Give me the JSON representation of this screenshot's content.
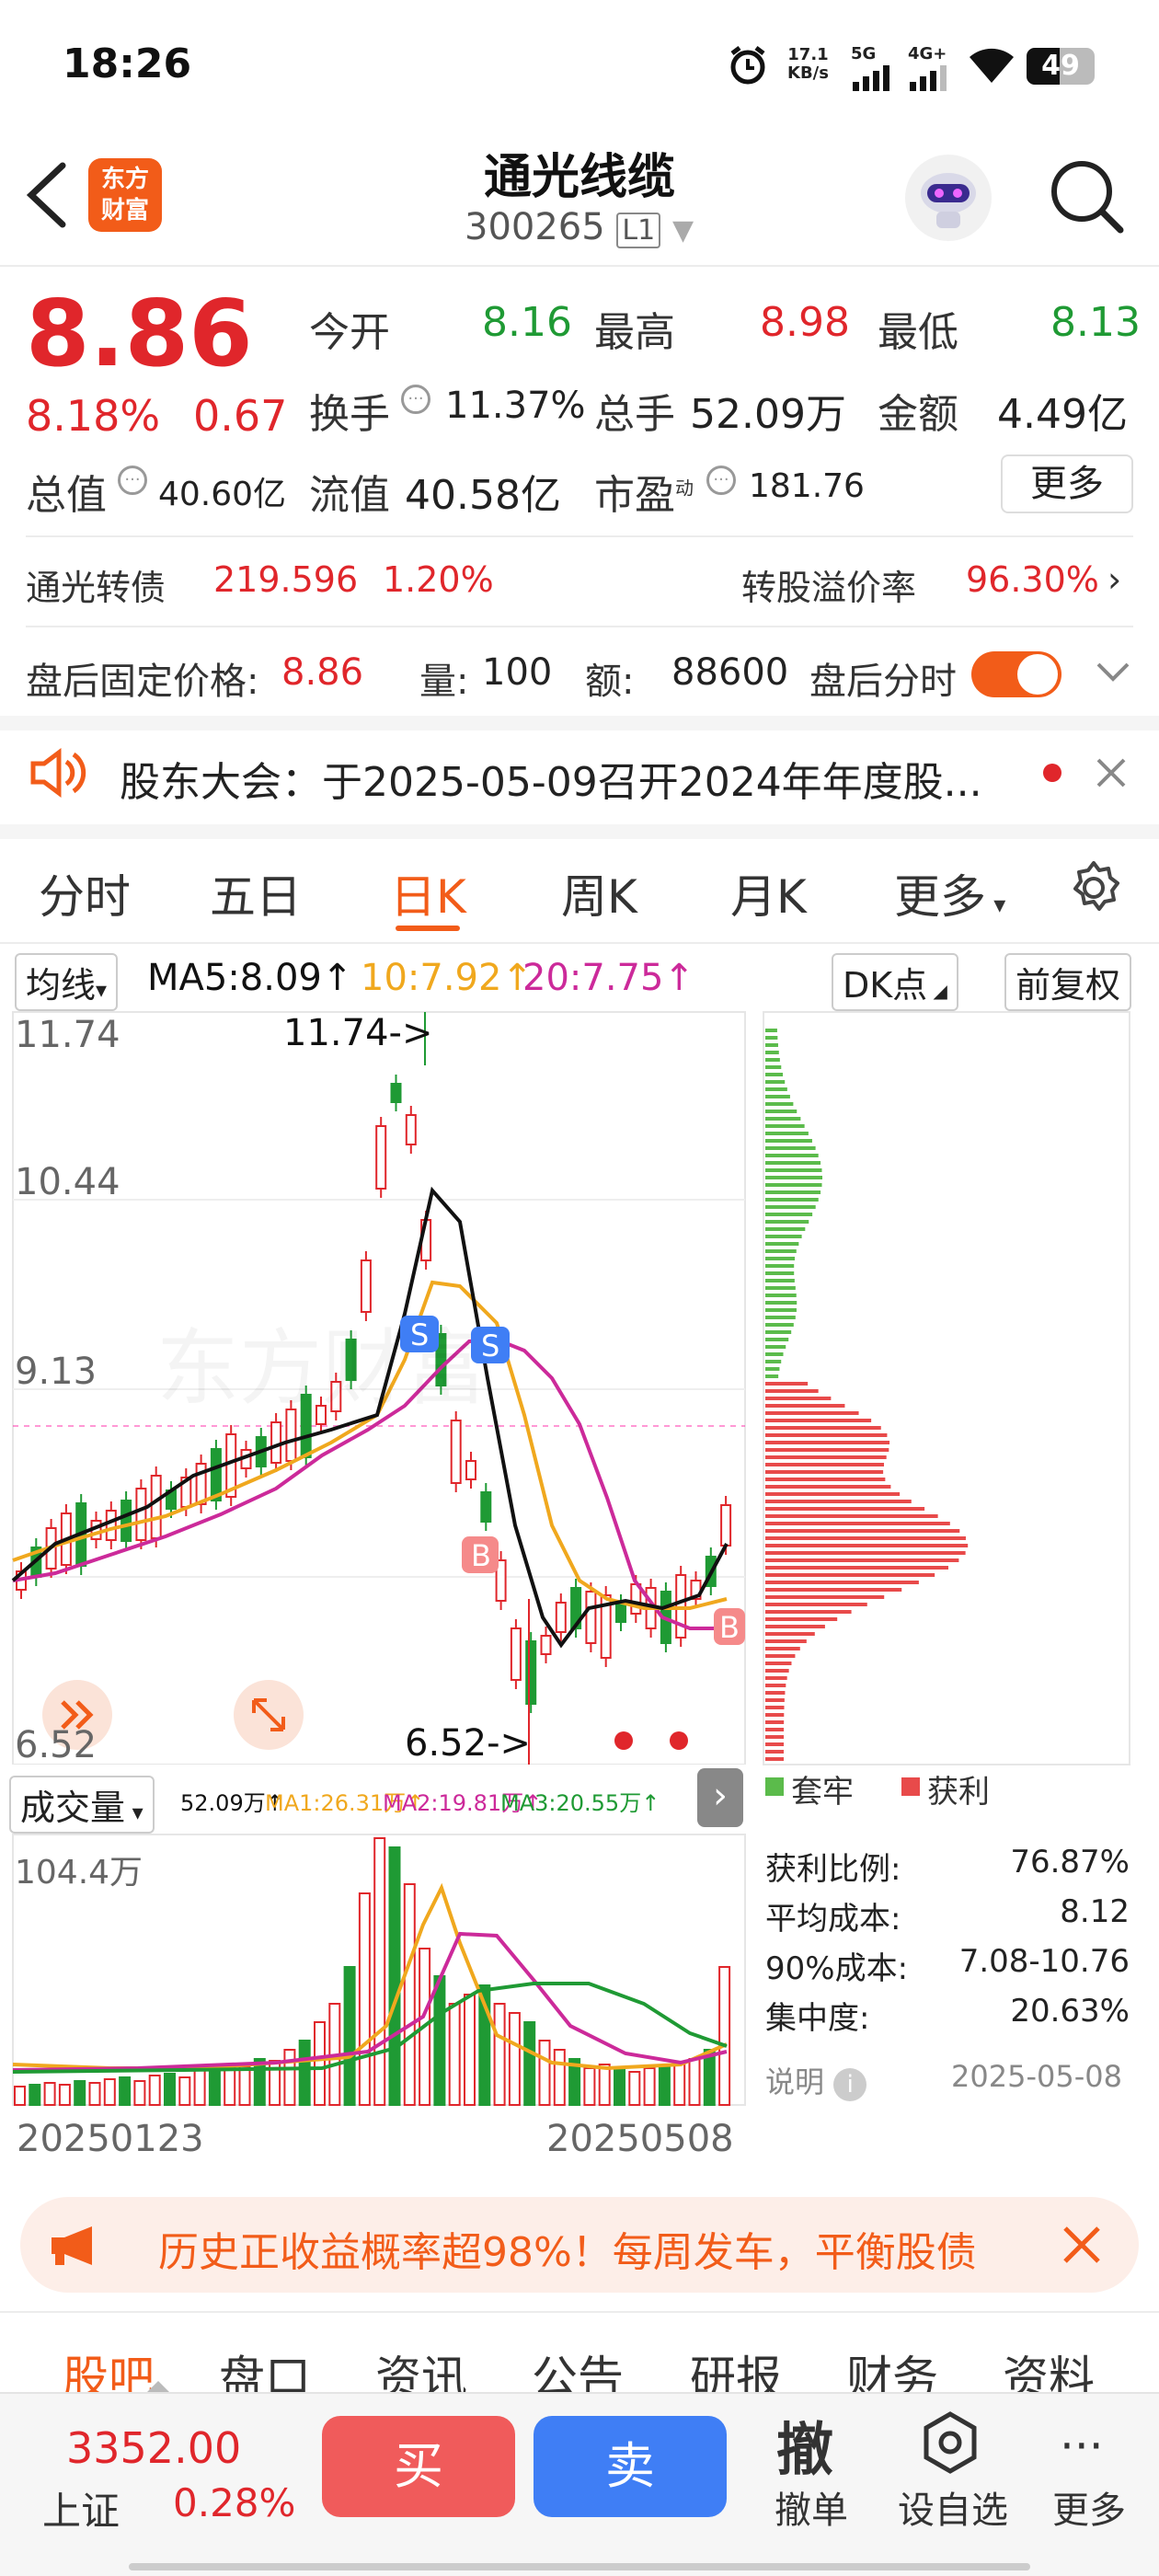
{
  "status_bar": {
    "time": "18:26",
    "net_speed_top": "17.1",
    "net_speed_bottom": "KB/s",
    "sig1": "5G",
    "sig2": "4G+",
    "battery": "49"
  },
  "header": {
    "logo_line1": "东方",
    "logo_line2": "财富",
    "title": "通光线缆",
    "code": "300265",
    "level": "L1"
  },
  "quote": {
    "price": "8.86",
    "pct": "8.18%",
    "change": "0.67",
    "open_label": "今开",
    "open": "8.16",
    "high_label": "最高",
    "high": "8.98",
    "low_label": "最低",
    "low": "8.13",
    "turnover_label": "换手",
    "turnover": "11.37%",
    "volume_label": "总手",
    "volume": "52.09万",
    "amount_label": "金额",
    "amount": "4.49亿",
    "mcap_label": "总值",
    "mcap": "40.60亿",
    "float_label": "流值",
    "float": "40.58亿",
    "pe_label": "市盈",
    "pe_sup": "动",
    "pe": "181.76",
    "more": "更多"
  },
  "bond": {
    "name": "通光转债",
    "price": "219.596",
    "pct": "1.20%",
    "premium_label": "转股溢价率",
    "premium": "96.30%"
  },
  "after_hours": {
    "label": "盘后固定价格:",
    "price": "8.86",
    "vol_label": "量:",
    "vol": "100",
    "amt_label": "额:",
    "amt": "88600",
    "toggle_label": "盘后分时"
  },
  "notice": {
    "text": "股东大会：于2025-05-09召开2024年年度股..."
  },
  "tabs": [
    "分时",
    "五日",
    "日K",
    "周K",
    "月K",
    "更多"
  ],
  "ma_bar": {
    "select": "均线",
    "ma5": "MA5:8.09",
    "ma10": "10:7.92",
    "ma20": "20:7.75",
    "dk": "DK点",
    "adj": "前复权"
  },
  "chart_labels": {
    "top": "11.74",
    "mid1": "10.44",
    "mid2": "9.13",
    "low": "6.52",
    "max_note": "11.74->",
    "min_note": "6.52->",
    "buy": "B",
    "sell": "S",
    "watermark": "东方财富"
  },
  "vol_bar": {
    "select": "成交量",
    "v": "52.09万",
    "ma1": "MA1:26.31万",
    "ma2": "MA2:19.81万",
    "ma3": "MA3:20.55万",
    "max": "104.4万",
    "date_start": "20250123",
    "date_end": "20250508"
  },
  "chip_dist": {
    "legend_trap": "套牢",
    "legend_profit": "获利",
    "rows": [
      {
        "k": "获利比例:",
        "v": "76.87%"
      },
      {
        "k": "平均成本:",
        "v": "8.12"
      },
      {
        "k": "90%成本:",
        "v": "7.08-10.76"
      },
      {
        "k": "集中度:",
        "v": "20.63%"
      }
    ],
    "note": "说明",
    "date": "2025-05-08"
  },
  "banner": {
    "text": "历史正收益概率超98%！每周发车，平衡股债"
  },
  "bottom_tabs": [
    "股吧",
    "盘口",
    "资讯",
    "公告",
    "研报",
    "财务",
    "资料"
  ],
  "footer": {
    "index_value": "3352.00",
    "index_name": "上证",
    "index_pct": "0.28%",
    "buy": "买",
    "sell": "卖",
    "cancel_icon": "撤",
    "cancel": "撤单",
    "watch": "设自选",
    "more": "更多"
  },
  "chart_data": [
    {
      "type": "candlestick",
      "title": "日K",
      "ylim": [
        6.52,
        11.74
      ],
      "y_ticks": [
        11.74,
        10.44,
        9.13,
        6.52
      ],
      "x_range": [
        "20250123",
        "20250508"
      ],
      "series": [
        {
          "name": "MA5",
          "value": 8.09
        },
        {
          "name": "10",
          "value": 7.92
        },
        {
          "name": "20",
          "value": 7.75
        }
      ],
      "annotations": [
        "11.74->",
        "6.52->",
        "B",
        "S"
      ]
    },
    {
      "type": "bar",
      "title": "成交量",
      "ylim": [
        0,
        104.4
      ],
      "series": [
        {
          "name": "MA1",
          "value": 26.31
        },
        {
          "name": "MA2",
          "value": 19.81
        },
        {
          "name": "MA3",
          "value": 20.55
        }
      ]
    }
  ],
  "colors": {
    "up": "#e0262b",
    "down": "#1f9a34",
    "accent": "#f25c19",
    "ma5": "#111111",
    "ma10": "#f0a81e",
    "ma20": "#cc2a9a",
    "sell_btn": "#f05b5b",
    "buy_btn": "#3f7ef5"
  }
}
